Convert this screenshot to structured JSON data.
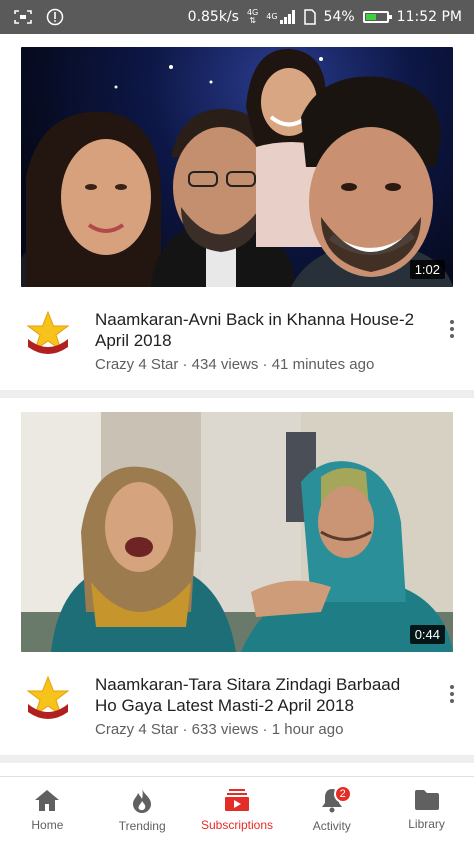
{
  "status_bar": {
    "speed": "0.85k/s",
    "net_top": "4G",
    "net_bottom": "4G",
    "battery": "54%",
    "battery_level": 0.54,
    "time": "11:52 PM"
  },
  "videos": [
    {
      "title": "Naamkaran-Avni Back in Khanna House-2 April 2018",
      "channel": "Crazy 4 Star",
      "views": "434 views",
      "age": "41 minutes ago",
      "meta": "Crazy 4 Star · 434 views · 41 minutes ago",
      "duration": "1:02"
    },
    {
      "title": "Naamkaran-Tara Sitara Zindagi Barbaad Ho Gaya Latest Masti-2 April 2018",
      "channel": "Crazy 4 Star",
      "views": "633 views",
      "age": "1 hour ago",
      "meta": "Crazy 4 Star · 633 views · 1 hour ago",
      "duration": "0:44"
    }
  ],
  "bottom_nav": {
    "items": [
      {
        "label": "Home",
        "icon": "home-icon"
      },
      {
        "label": "Trending",
        "icon": "flame-icon"
      },
      {
        "label": "Subscriptions",
        "icon": "subscriptions-icon"
      },
      {
        "label": "Activity",
        "icon": "bell-icon",
        "badge": "2"
      },
      {
        "label": "Library",
        "icon": "folder-icon"
      }
    ],
    "active": "Subscriptions"
  },
  "colors": {
    "accent": "#e52d27",
    "status_bar": "#5a5a5a",
    "text_secondary": "#5f5f5f"
  }
}
